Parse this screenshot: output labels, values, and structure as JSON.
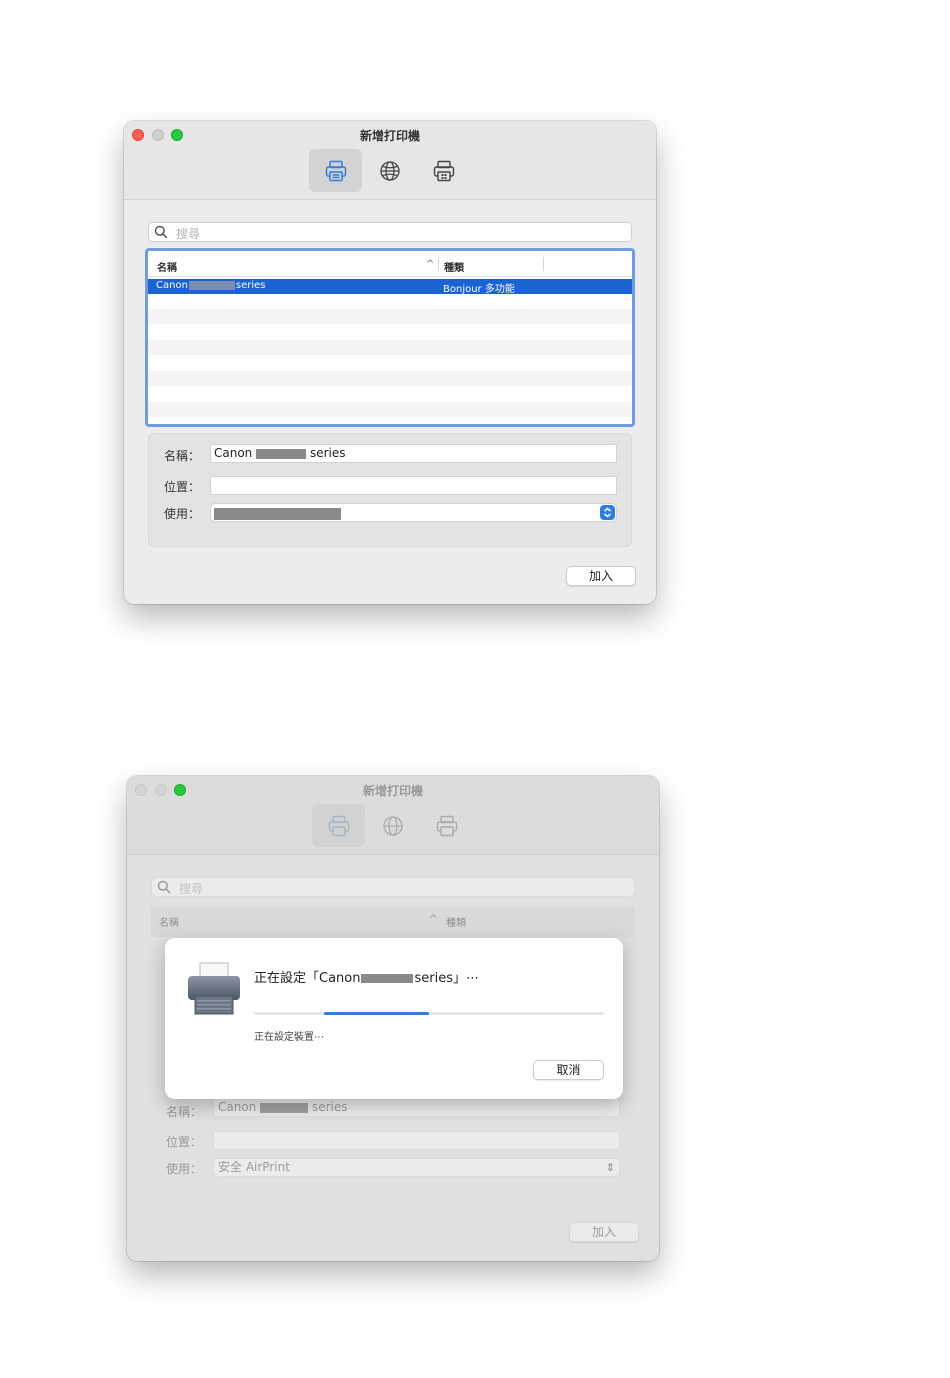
{
  "window1": {
    "title": "新增打印機",
    "toolbar": {
      "icons": [
        "default-printer-icon",
        "ip-globe-icon",
        "windows-printer-icon"
      ],
      "selected": 0
    },
    "search": {
      "placeholder": "搜尋"
    },
    "list": {
      "col_name": "名稱",
      "col_kind": "種類",
      "sort_indicator": "^",
      "rows": [
        {
          "name_prefix": "Canon",
          "name_suffix": "series",
          "kind": "Bonjour 多功能",
          "selected": true
        }
      ]
    },
    "form": {
      "name_label": "名稱：",
      "name_prefix": "Canon",
      "name_suffix": "series",
      "location_label": "位置：",
      "location_value": "",
      "use_label": "使用："
    },
    "add_button": "加入"
  },
  "window2": {
    "title": "新增打印機",
    "search": {
      "placeholder": "搜尋"
    },
    "list": {
      "col_name": "名稱",
      "col_kind": "種類",
      "sort_indicator": "^"
    },
    "form": {
      "name_label": "名稱：",
      "name_prefix": "Canon",
      "name_suffix": "series",
      "location_label": "位置：",
      "use_label": "使用：",
      "use_value": "安全 AirPrint"
    },
    "add_button": "加入",
    "sheet": {
      "message_prefix": "正在設定「Canon",
      "message_suffix": "series」⋯",
      "status": "正在設定裝置⋯",
      "cancel_button": "取消",
      "progress_start": 0.2,
      "progress_end": 0.5
    }
  },
  "colors": {
    "accent": "#1b63d0",
    "focus_ring": "#6f9de0",
    "close": "#ff5f57",
    "maximize": "#28c840"
  }
}
